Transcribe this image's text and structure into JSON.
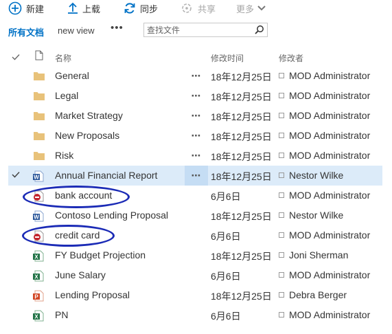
{
  "toolbar": {
    "new_label": "新建",
    "upload_label": "上载",
    "sync_label": "同步",
    "share_label": "共享",
    "more_label": "更多"
  },
  "views": {
    "all_docs": "所有文档",
    "new_view": "new view",
    "more": "•••"
  },
  "search": {
    "placeholder": "查找文件"
  },
  "columns": {
    "name": "名称",
    "modified": "修改时间",
    "modified_by": "修改者"
  },
  "rows": [
    {
      "name": "General",
      "modified": "18年12月25日",
      "modified_by": "MOD Administrator",
      "icon": "folder-icon"
    },
    {
      "name": "Legal",
      "modified": "18年12月25日",
      "modified_by": "MOD Administrator",
      "icon": "folder-icon"
    },
    {
      "name": "Market Strategy",
      "modified": "18年12月25日",
      "modified_by": "MOD Administrator",
      "icon": "folder-icon"
    },
    {
      "name": "New Proposals",
      "modified": "18年12月25日",
      "modified_by": "MOD Administrator",
      "icon": "folder-icon"
    },
    {
      "name": "Risk",
      "modified": "18年12月25日",
      "modified_by": "MOD Administrator",
      "icon": "folder-icon"
    },
    {
      "name": "Annual Financial Report",
      "modified": "18年12月25日",
      "modified_by": "Nestor Wilke",
      "icon": "word-doc-icon",
      "selected": true
    },
    {
      "name": "bank account",
      "modified": "6月6日",
      "modified_by": "MOD Administrator",
      "icon": "blocked-file-icon"
    },
    {
      "name": "Contoso Lending Proposal",
      "modified": "18年12月25日",
      "modified_by": "Nestor Wilke",
      "icon": "word-doc-icon"
    },
    {
      "name": "credit card",
      "modified": "6月6日",
      "modified_by": "MOD Administrator",
      "icon": "blocked-file-icon"
    },
    {
      "name": "FY Budget Projection",
      "modified": "18年12月25日",
      "modified_by": "Joni Sherman",
      "icon": "excel-doc-icon"
    },
    {
      "name": "June Salary",
      "modified": "6月6日",
      "modified_by": "MOD Administrator",
      "icon": "excel-doc-icon"
    },
    {
      "name": "Lending Proposal",
      "modified": "18年12月25日",
      "modified_by": "Debra Berger",
      "icon": "powerpoint-doc-icon"
    },
    {
      "name": "PN",
      "modified": "6月6日",
      "modified_by": "MOD Administrator",
      "icon": "excel-doc-icon"
    }
  ],
  "colors": {
    "accent": "#0072c6",
    "selected_row": "#dcebf9",
    "folder": "#e8c27a",
    "word": "#2b579a",
    "excel": "#217346",
    "powerpoint": "#d24726",
    "blocked": "#c4262e",
    "annotation_ink": "#1b2bb6"
  }
}
